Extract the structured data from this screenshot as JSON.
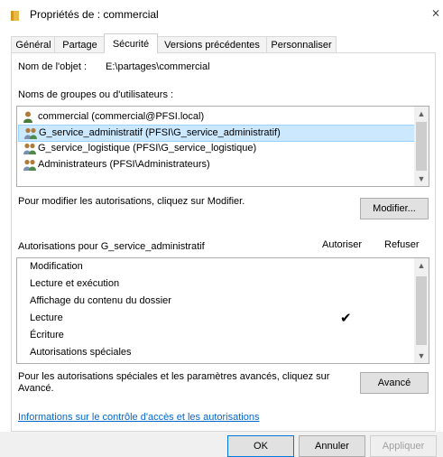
{
  "window": {
    "title": "Propriétés de : commercial",
    "close": "⨯",
    "folder_icon": "folder-icon"
  },
  "tabs": [
    {
      "label": "Général"
    },
    {
      "label": "Partage"
    },
    {
      "label": "Sécurité",
      "active": true
    },
    {
      "label": "Versions précédentes"
    },
    {
      "label": "Personnaliser"
    }
  ],
  "object_name": {
    "label": "Nom de l'objet :",
    "value": "E:\\partages\\commercial"
  },
  "groups": {
    "label": "Noms de groupes ou d'utilisateurs :",
    "items": [
      {
        "text": "commercial (commercial@PFSI.local)",
        "icon": "user-icon"
      },
      {
        "text": "G_service_administratif (PFSI\\G_service_administratif)",
        "icon": "group-icon",
        "selected": true
      },
      {
        "text": "G_service_logistique (PFSI\\G_service_logistique)",
        "icon": "group-icon"
      },
      {
        "text": "Administrateurs (PFSI\\Administrateurs)",
        "icon": "group-icon"
      }
    ]
  },
  "modify_hint": "Pour modifier les autorisations, cliquez sur Modifier.",
  "modify_button": "Modifier...",
  "permissions": {
    "label": "Autorisations pour G_service_administratif",
    "allow_header": "Autoriser",
    "deny_header": "Refuser",
    "items": [
      {
        "name": "Modification",
        "allow": false
      },
      {
        "name": "Lecture et exécution",
        "allow": false
      },
      {
        "name": "Affichage du contenu du dossier",
        "allow": false
      },
      {
        "name": "Lecture",
        "allow": true
      },
      {
        "name": "Écriture",
        "allow": false
      },
      {
        "name": "Autorisations spéciales",
        "allow": false
      }
    ],
    "check_glyph": "✔"
  },
  "advanced_hint": "Pour les autorisations spéciales et les paramètres avancés, cliquez sur Avancé.",
  "advanced_button": "Avancé",
  "info_link": "Informations sur le contrôle d'accès et les autorisations",
  "footer": {
    "ok": "OK",
    "cancel": "Annuler",
    "apply": "Appliquer"
  },
  "colors": {
    "selection": "#cce8ff",
    "link": "#0066cc",
    "folder": "#e8b948",
    "user": "#4a7a3a",
    "group": "#7a8fb5"
  }
}
